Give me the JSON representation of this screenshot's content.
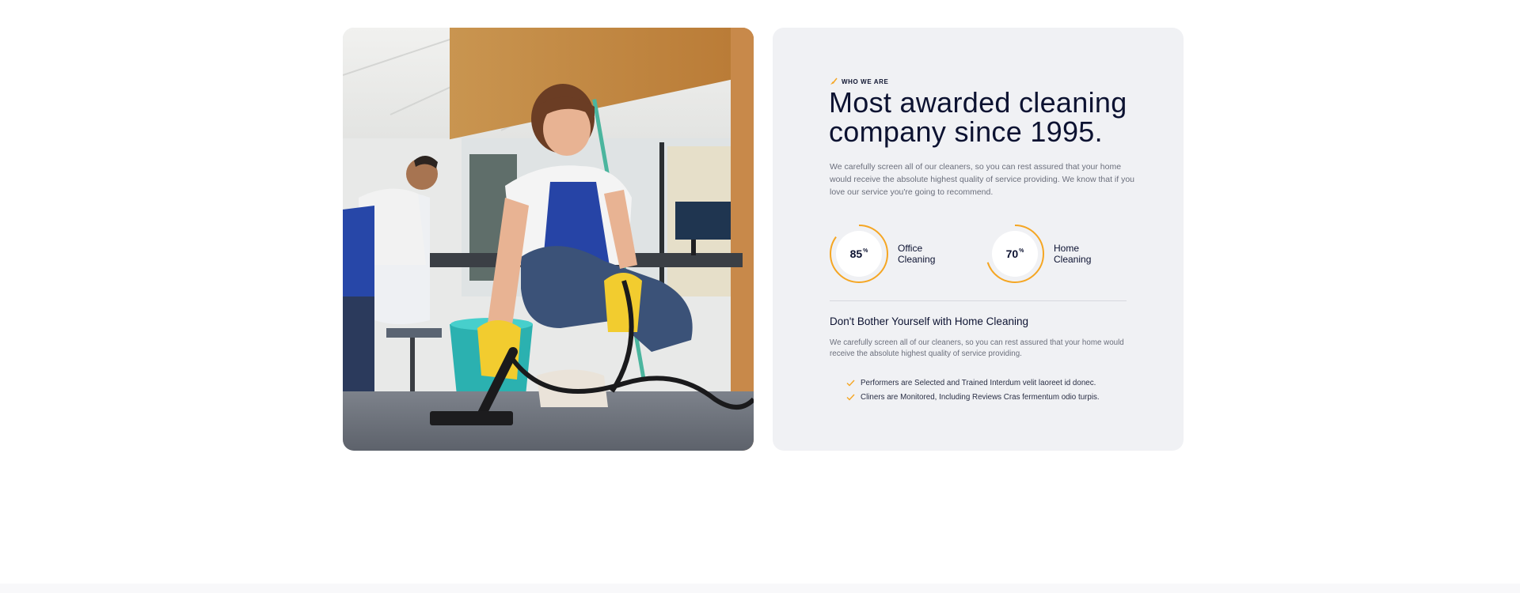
{
  "about": {
    "eyebrow": "WHO WE ARE",
    "eyebrow_icon": "broom-icon",
    "headline": "Most awarded cleaning company since 1995.",
    "intro": "We carefully screen all of our cleaners, so you can rest assured that your home would receive the absolute highest quality of service providing. We know that if you love our service you're going to recommend."
  },
  "stats": [
    {
      "value": "85",
      "unit": "%",
      "percent": 85,
      "label": "Office Cleaning"
    },
    {
      "value": "70",
      "unit": "%",
      "percent": 70,
      "label": "Home Cleaning"
    }
  ],
  "section2": {
    "title": "Don't Bother Yourself with Home Cleaning",
    "body": "We carefully screen all of our cleaners, so you can rest assured that your home would receive the absolute highest quality of service providing."
  },
  "checklist": [
    "Performers are Selected and Trained Interdum velit laoreet id donec.",
    "Cliners are Monitored, Including Reviews Cras fermentum odio turpis."
  ],
  "colors": {
    "accent": "#f5a623",
    "heading": "#0c1231",
    "card_bg": "#f0f1f4",
    "muted_text": "#6b6f7c"
  },
  "photo": {
    "icon": "cleaning-photo"
  }
}
